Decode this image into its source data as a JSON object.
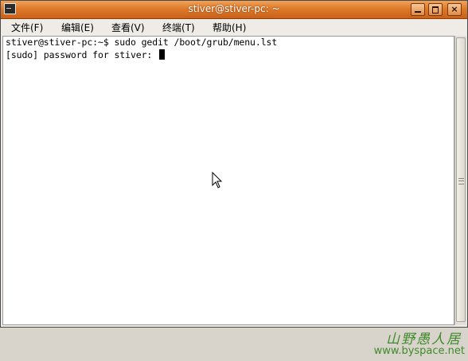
{
  "window": {
    "title": "stiver@stiver-pc: ~",
    "icon": "terminal-icon",
    "controls": {
      "minimize": "minimize-icon",
      "maximize": "maximize-icon",
      "close": "×"
    }
  },
  "menu": [
    {
      "label": "文件(F)"
    },
    {
      "label": "编辑(E)"
    },
    {
      "label": "查看(V)"
    },
    {
      "label": "终端(T)"
    },
    {
      "label": "帮助(H)"
    }
  ],
  "terminal": {
    "lines": [
      "stiver@stiver-pc:~$ sudo gedit /boot/grub/menu.lst",
      "[sudo] password for stiver: "
    ]
  },
  "watermark": {
    "chinese": "山野愚人居",
    "url": "www.byspace.net"
  },
  "colors": {
    "titlebar": "#de7a2a",
    "window_bg": "#efebe7",
    "terminal_bg": "#ffffff",
    "watermark": "#3f8a2a"
  }
}
